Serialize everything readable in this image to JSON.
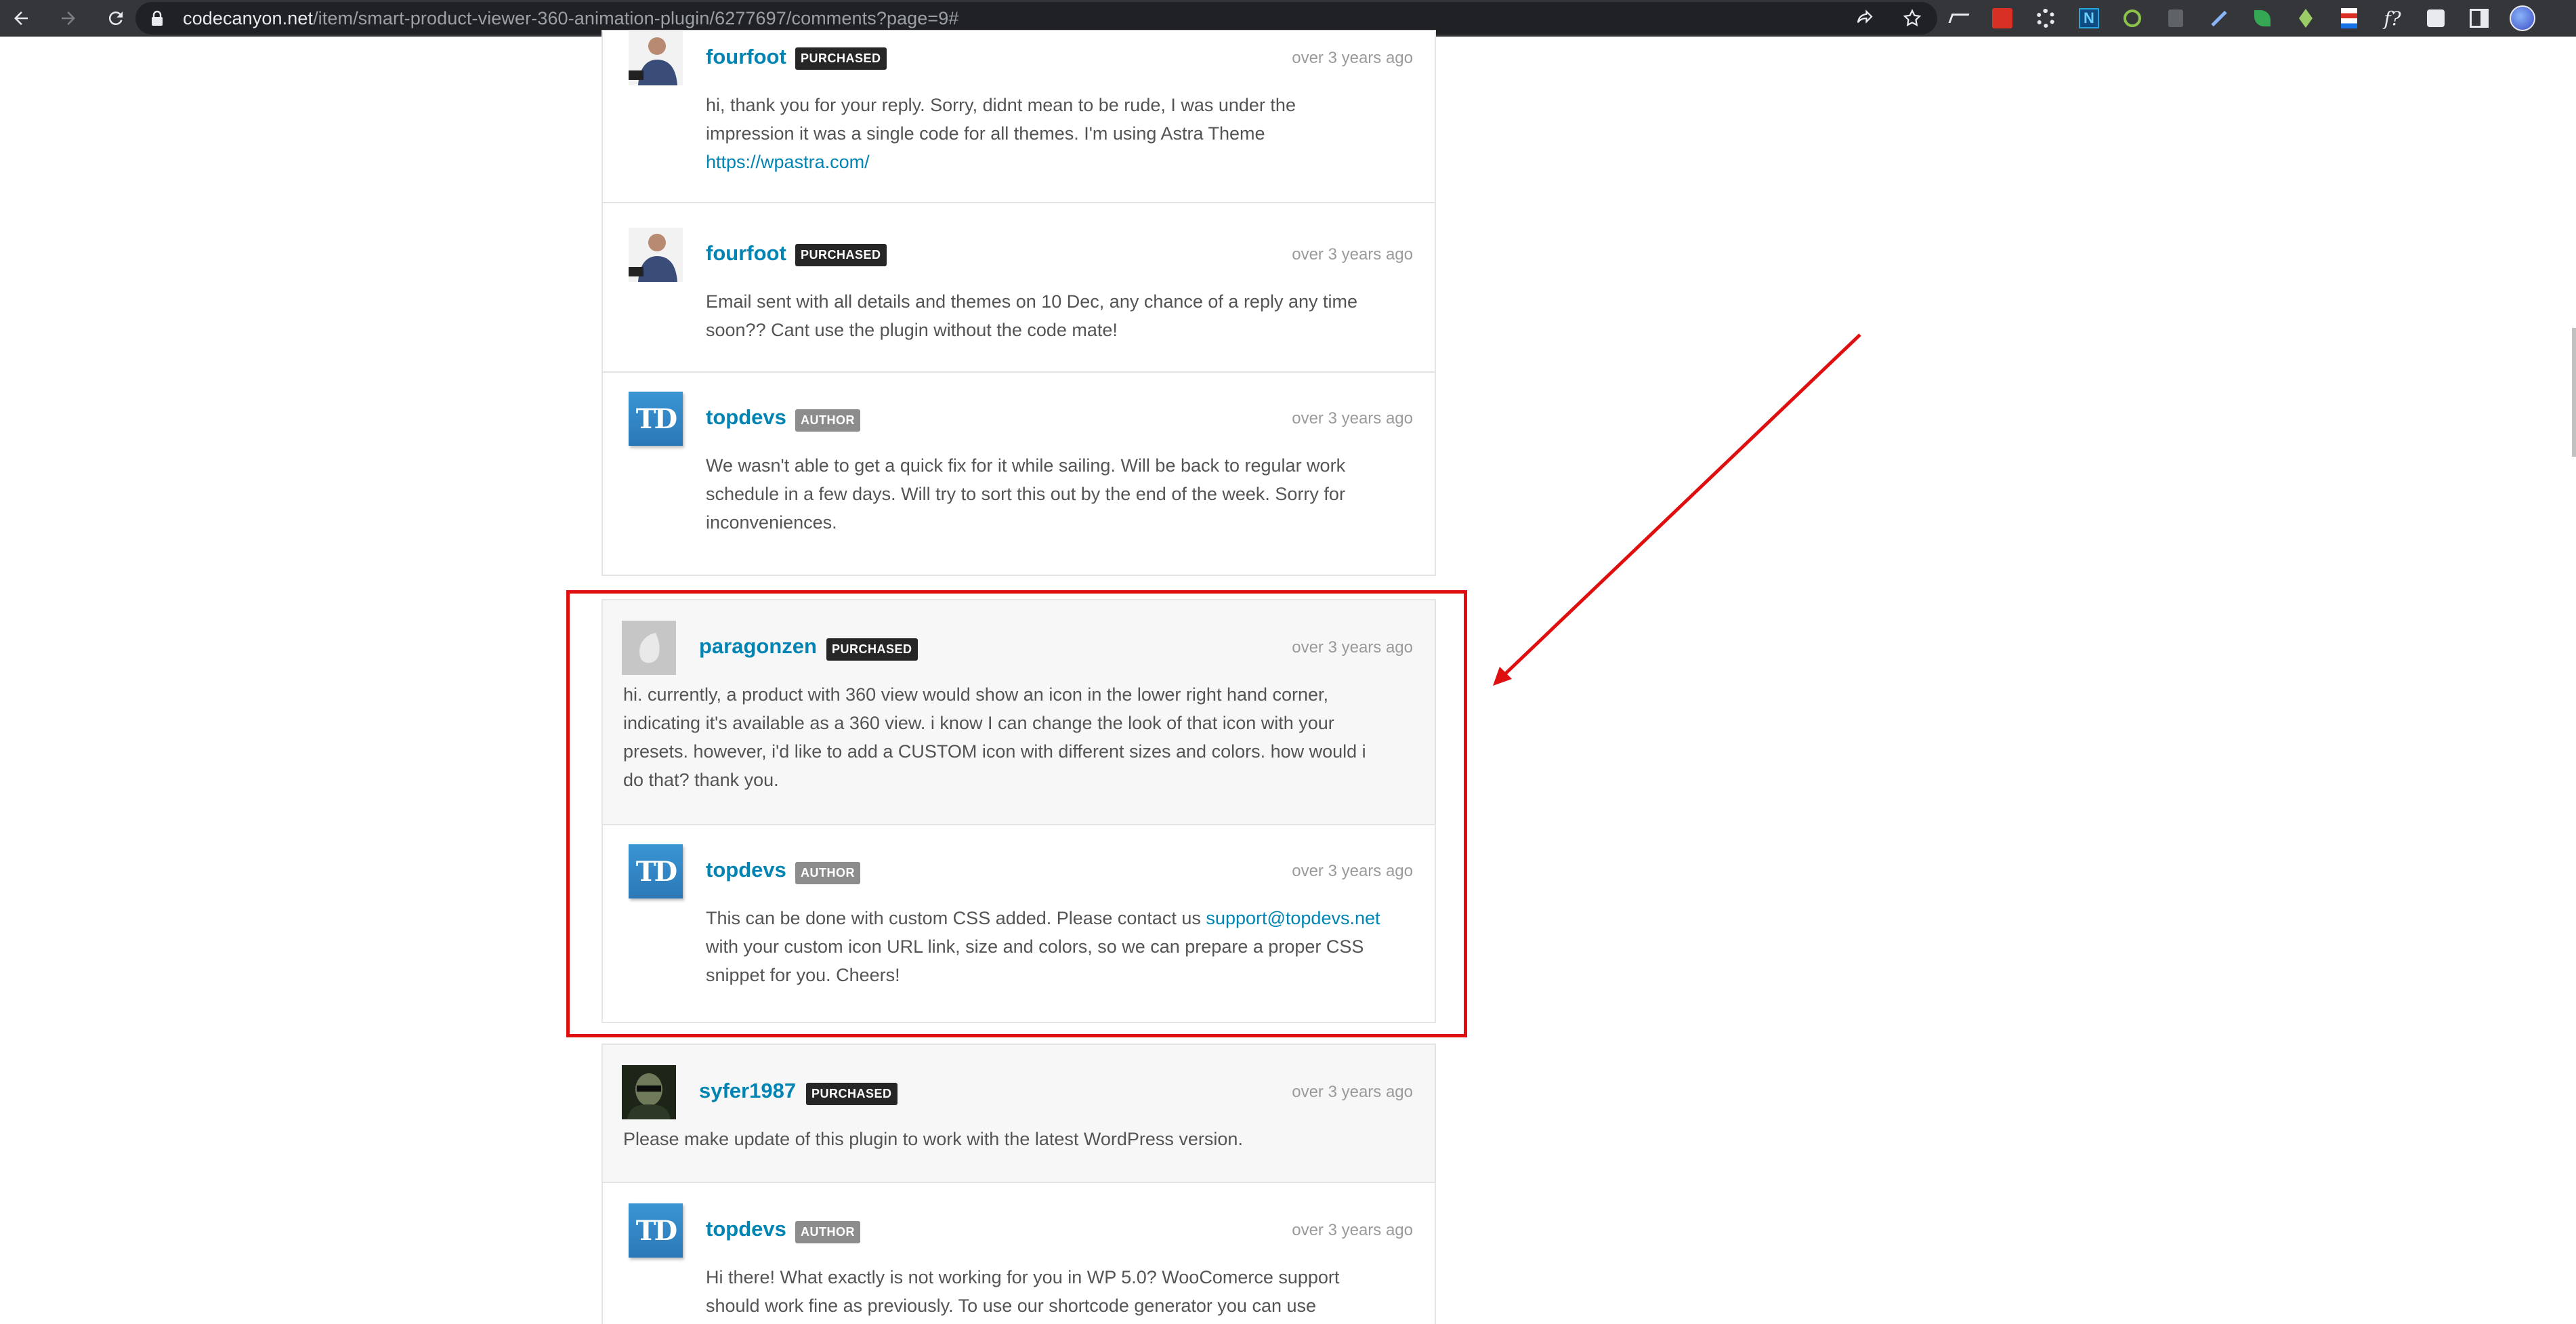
{
  "browser": {
    "url_host": "codecanyon.net",
    "url_path": "/item/smart-product-viewer-360-animation-plugin/6277697/comments?page=9#"
  },
  "comments": [
    {
      "username": "fourfoot",
      "badge": "PURCHASED",
      "time": "over 3 years ago",
      "lines": [
        "hi, thank you for your reply. Sorry, didnt mean to be rude, I was under the",
        "impression it was a single code for all themes. I'm using Astra Theme"
      ],
      "link": "https://wpastra.com/"
    },
    {
      "username": "fourfoot",
      "badge": "PURCHASED",
      "time": "over 3 years ago",
      "lines": [
        "Email sent with all details and themes on 10 Dec, any chance of a reply any time",
        "soon?? Cant use the plugin without the code mate!"
      ]
    },
    {
      "username": "topdevs",
      "badge": "AUTHOR",
      "time": "over 3 years ago",
      "lines": [
        "We wasn't able to get a quick fix for it while sailing. Will be back to regular work",
        "schedule in a few days. Will try to sort this out by the end of the week. Sorry for",
        "inconveniences."
      ]
    },
    {
      "username": "paragonzen",
      "badge": "PURCHASED",
      "time": "over 3 years ago",
      "lines": [
        "hi. currently, a product with 360 view would show an icon in the lower right hand corner,",
        "indicating it's available as a 360 view. i know I can change the look of that icon with your",
        "presets. however, i'd like to add a CUSTOM icon with different sizes and colors. how would i",
        "do that? thank you."
      ]
    },
    {
      "username": "topdevs",
      "badge": "AUTHOR",
      "time": "over 3 years ago",
      "line1_before_link": "This can be done with custom CSS added. Please contact us ",
      "link": "support@topdevs.net",
      "lines": [
        "with your custom icon URL link, size and colors, so we can prepare a proper CSS",
        "snippet for you. Cheers!"
      ]
    },
    {
      "username": "syfer1987",
      "badge": "PURCHASED",
      "time": "over 3 years ago",
      "lines": [
        "Please make update of this plugin to work with the latest WordPress version."
      ]
    },
    {
      "username": "topdevs",
      "badge": "AUTHOR",
      "time": "over 3 years ago",
      "lines": [
        "Hi there! What exactly is not working for you in WP 5.0? WooComerce support",
        "should work fine as previously. To use our shortcode generator you can use"
      ]
    }
  ],
  "avatar_initials": "TD",
  "colors": {
    "username": "#0084b4",
    "purchased_badge": "#262626",
    "author_badge": "#8c8c8c",
    "annotation": "#e00f0f"
  }
}
